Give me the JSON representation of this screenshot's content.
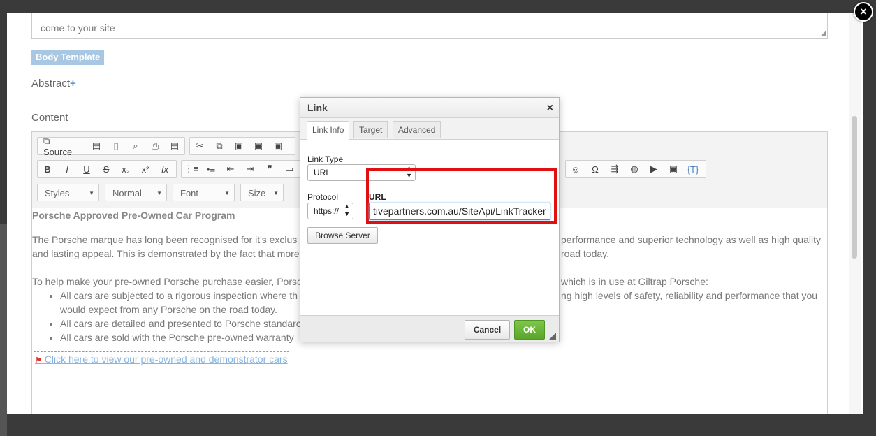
{
  "modal": {
    "close_label": "×",
    "textarea_text": "come to your site",
    "body_template_label": "Body Template",
    "abstract_label": "Abstract",
    "abstract_plus": "+",
    "content_label": "Content"
  },
  "toolbar": {
    "source_label": "Source",
    "styles_label": "Styles",
    "format_label": "Normal",
    "font_label": "Font",
    "size_label": "Size",
    "template_label": "{T}"
  },
  "content": {
    "title": "Porsche Approved Pre-Owned Car Program",
    "paragraph1_left": "The Porsche marque has long been recognised for it's exclus",
    "paragraph1_right": "performance and superior technology as well as high quality",
    "paragraph1_line2_left": "and lasting appeal. This is demonstrated by the fact that more",
    "paragraph1_line2_right": "road today.",
    "paragraph2_left": "To help make your pre-owned Porsche purchase easier, Porsc",
    "paragraph2_right": "which is in use at Giltrap Porsche:",
    "bullets": [
      {
        "left": "All cars are subjected to a rigorous inspection where th",
        "right": "ng high levels of safety, reliability and performance that you",
        "line2": "would expect from any Porsche on the road today."
      },
      {
        "left": "All cars are detailed and presented to Porsche standarc",
        "right": "",
        "line2": ""
      },
      {
        "left": "All cars are sold with the Porsche pre-owned warranty",
        "right": "",
        "line2": ""
      }
    ],
    "link_text": "Click here to view our pre-owned and demonstrator cars"
  },
  "dialog": {
    "title": "Link",
    "close": "×",
    "tabs": [
      {
        "label": "Link Info",
        "active": true
      },
      {
        "label": "Target",
        "active": false
      },
      {
        "label": "Advanced",
        "active": false
      }
    ],
    "link_type_label": "Link Type",
    "link_type_value": "URL",
    "protocol_label": "Protocol",
    "protocol_value": "https://",
    "url_label": "URL",
    "url_value": "tivepartners.com.au/SiteApi/LinkTracker",
    "browse_server_label": "Browse Server",
    "cancel_label": "Cancel",
    "ok_label": "OK"
  },
  "colors": {
    "ok_button": "#5aa62a",
    "highlight_box": "#e01010",
    "link_text": "#88b4e0",
    "body_template_badge": "#a8c7e2"
  }
}
